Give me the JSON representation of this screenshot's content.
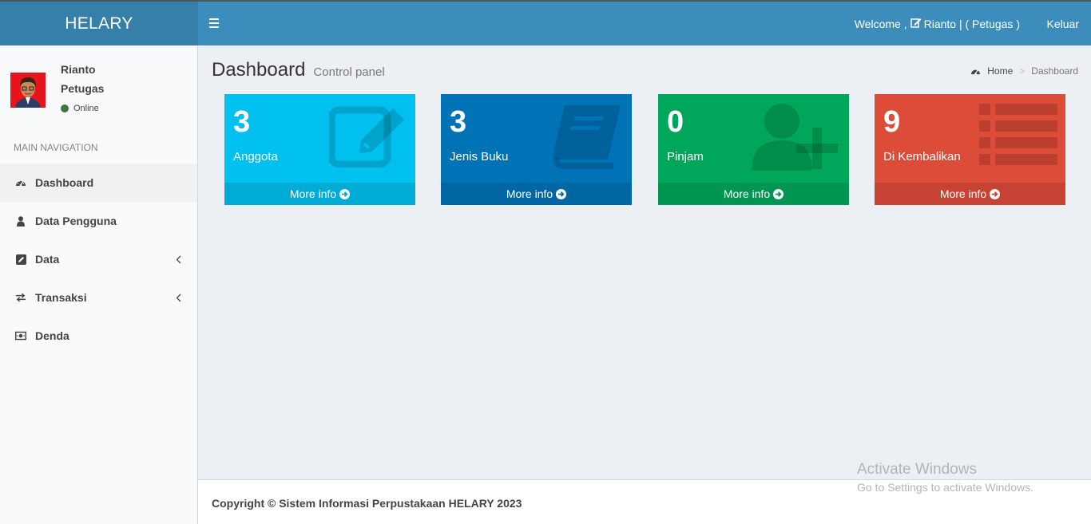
{
  "header": {
    "logo": "HELARY",
    "welcome_prefix": "Welcome ,",
    "welcome_user": "Rianto | ( Petugas )",
    "logout": "Keluar"
  },
  "sidebar": {
    "user_name": "Rianto",
    "user_role": "Petugas",
    "status": "Online",
    "nav_header": "MAIN NAVIGATION",
    "items": [
      {
        "label": "Dashboard",
        "icon": "dashboard-icon",
        "active": true
      },
      {
        "label": "Data Pengguna",
        "icon": "user-icon"
      },
      {
        "label": "Data",
        "icon": "edit-icon",
        "has_children": true
      },
      {
        "label": "Transaksi",
        "icon": "exchange-icon",
        "has_children": true
      },
      {
        "label": "Denda",
        "icon": "money-icon"
      }
    ]
  },
  "content": {
    "title": "Dashboard",
    "subtitle": "Control panel",
    "breadcrumb": {
      "home": "Home",
      "current": "Dashboard"
    },
    "boxes": [
      {
        "value": "3",
        "label": "Anggota",
        "more": "More info",
        "color": "#00c0ef",
        "icon": "edit-icon"
      },
      {
        "value": "3",
        "label": "Jenis Buku",
        "more": "More info",
        "color": "#0073b7",
        "icon": "book-icon"
      },
      {
        "value": "0",
        "label": "Pinjam",
        "more": "More info",
        "color": "#00a65a",
        "icon": "user-plus-icon"
      },
      {
        "value": "9",
        "label": "Di Kembalikan",
        "more": "More info",
        "color": "#dd4b39",
        "icon": "list-icon"
      }
    ]
  },
  "footer": {
    "copyright": "Copyright © Sistem Informasi Perpustakaan HELARY 2023"
  },
  "watermark": {
    "line1": "Activate Windows",
    "line2": "Go to Settings to activate Windows."
  }
}
